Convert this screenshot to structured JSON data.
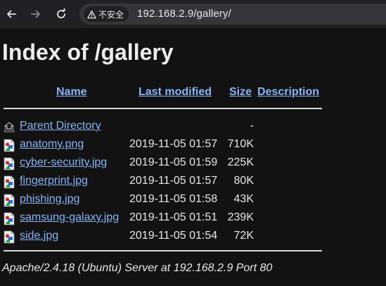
{
  "browser": {
    "security_label": "不安全",
    "url": "192.168.2.9/gallery/",
    "back_icon": "back-arrow-icon",
    "forward_icon": "forward-arrow-icon",
    "reload_icon": "reload-icon",
    "warning_icon": "warning-triangle-icon"
  },
  "page": {
    "title": "Index of /gallery",
    "columns": {
      "name": "Name",
      "last_modified": "Last modified",
      "size": "Size",
      "description": "Description"
    },
    "parent": {
      "label": "Parent Directory",
      "size": "-",
      "icon": "back-folder-icon"
    },
    "files": [
      {
        "name": "anatomy.png",
        "modified": "2019-11-05 01:57",
        "size": "710K",
        "icon": "image-file-icon"
      },
      {
        "name": "cyber-security.jpg",
        "modified": "2019-11-05 01:59",
        "size": "225K",
        "icon": "image-file-icon"
      },
      {
        "name": "fingerprint.jpg",
        "modified": "2019-11-05 01:57",
        "size": "80K",
        "icon": "image-file-icon"
      },
      {
        "name": "phishing.jpg",
        "modified": "2019-11-05 01:58",
        "size": "43K",
        "icon": "image-file-icon"
      },
      {
        "name": "samsung-galaxy.jpg",
        "modified": "2019-11-05 01:51",
        "size": "239K",
        "icon": "image-file-icon"
      },
      {
        "name": "side.jpg",
        "modified": "2019-11-05 01:54",
        "size": "72K",
        "icon": "image-file-icon"
      }
    ],
    "footer": "Apache/2.4.18 (Ubuntu) Server at 192.168.2.9 Port 80"
  },
  "colors": {
    "background": "#121212",
    "link": "#8ab4f8",
    "toolbar": "#202124",
    "omnibox": "#35363a"
  }
}
